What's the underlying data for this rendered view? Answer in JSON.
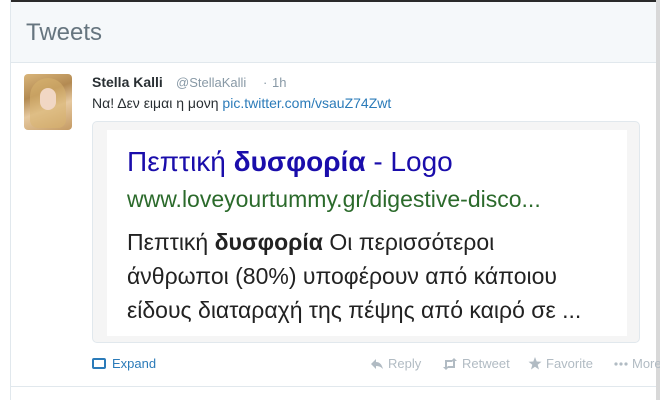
{
  "header": {
    "title": "Tweets"
  },
  "tweet": {
    "author_name": "Stella Kalli",
    "author_handle": "@StellaKalli",
    "separator": "·",
    "timestamp": "1h",
    "text": "Να! Δεν ειμαι η μονη",
    "link": "pic.twitter.com/vsauZ74Zwt",
    "media": {
      "title_normal_1": "Πεπτική",
      "title_bold": "δυσφορία",
      "title_normal_2": "- Logo",
      "url": "www.loveyourtummy.gr/digestive-disco...",
      "desc_line1_normal": "Πεπτική",
      "desc_line1_bold": "δυσφορία",
      "desc_line1_rest": "Οι περισσότεροι",
      "desc_line2": "άνθρωποι (80%) υποφέρουν από κάποιου",
      "desc_line3": "είδους διαταραχή της πέψης από καιρό σε ..."
    }
  },
  "actions": {
    "expand": "Expand",
    "reply": "Reply",
    "retweet": "Retweet",
    "favorite": "Favorite",
    "more": "More"
  },
  "colors": {
    "link": "#2b7bb9",
    "muted": "#8899a6",
    "card_title": "#1a0dab",
    "card_url": "#2b6a2b"
  }
}
